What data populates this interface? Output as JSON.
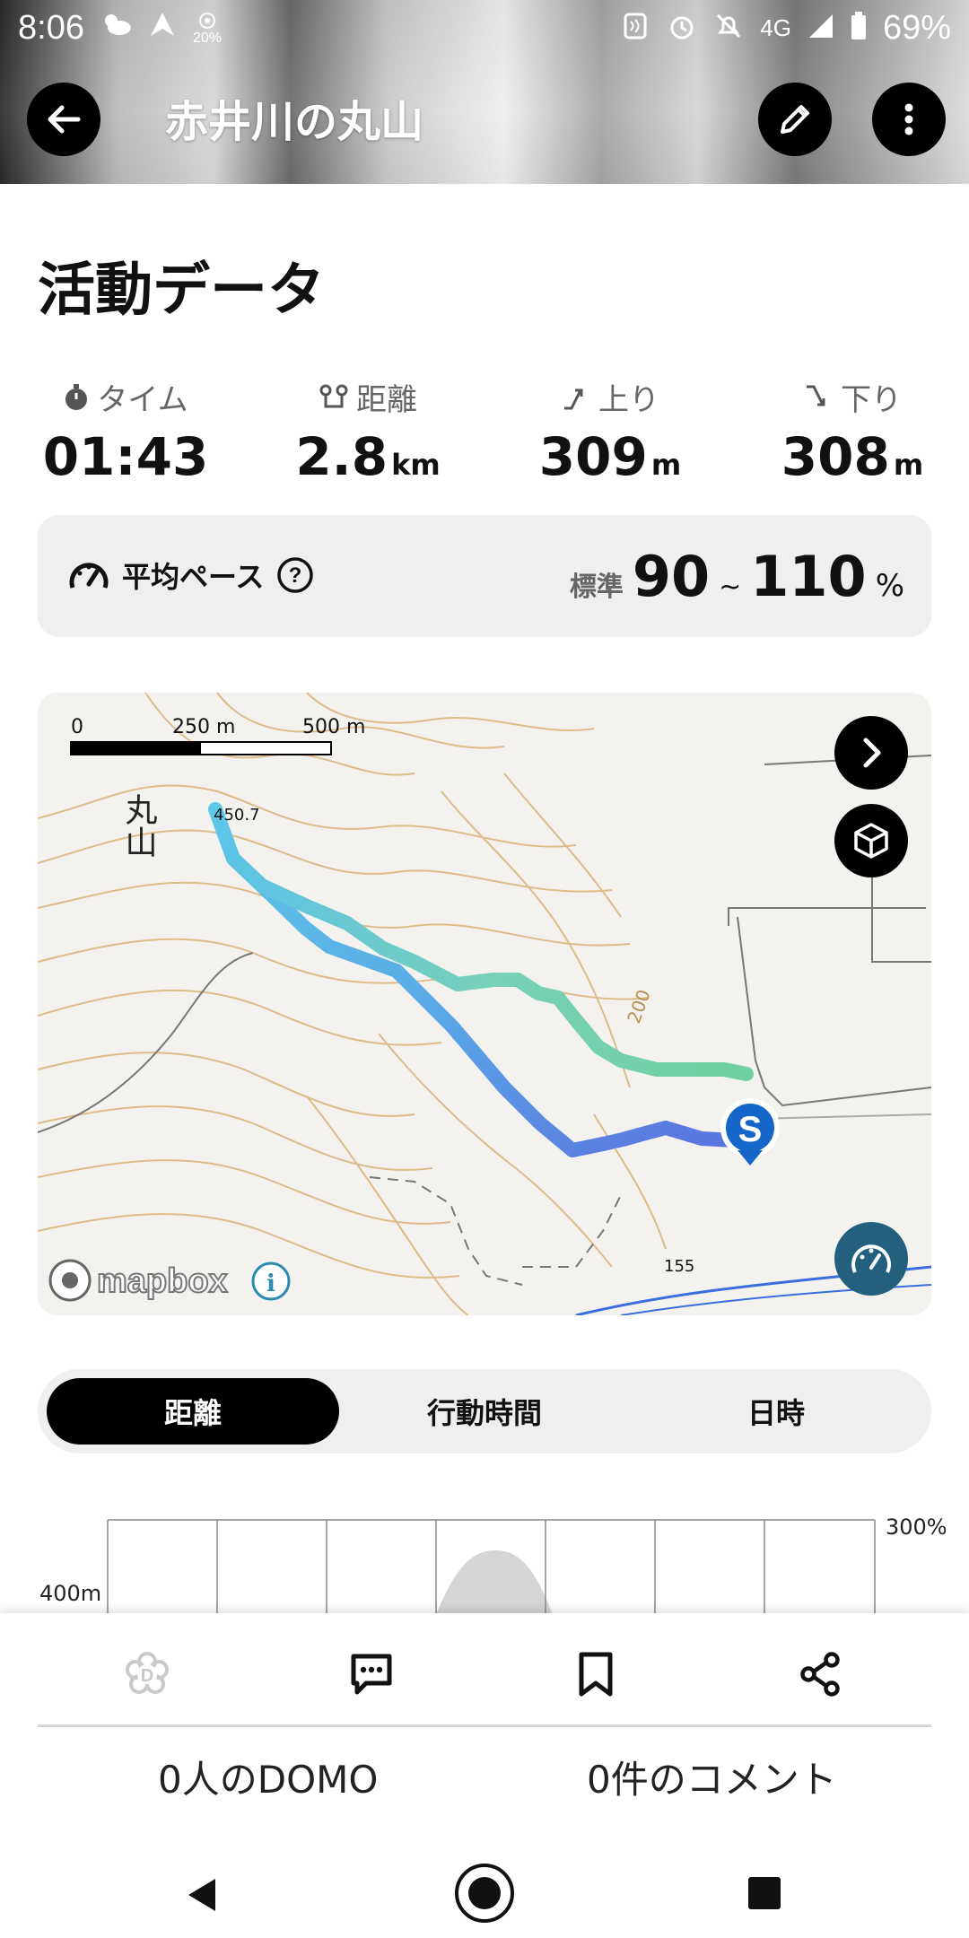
{
  "status_bar": {
    "time": "8:06",
    "temperature": "20%",
    "network": "4G",
    "battery": "69%"
  },
  "header": {
    "title": "赤井川の丸山",
    "back_icon": "arrow-left-icon",
    "edit_icon": "pencil-icon",
    "more_icon": "more-vertical-icon"
  },
  "activity": {
    "section_title": "活動データ",
    "stats": [
      {
        "label": "タイム",
        "value": "01:43",
        "unit": "",
        "icon": "stopwatch-icon"
      },
      {
        "label": "距離",
        "value": "2.8",
        "unit": "km",
        "icon": "route-icon"
      },
      {
        "label": "上り",
        "value": "309",
        "unit": "m",
        "icon": "ascent-icon"
      },
      {
        "label": "下り",
        "value": "308",
        "unit": "m",
        "icon": "descent-icon"
      }
    ],
    "pace": {
      "label": "平均ペース",
      "standard_label": "標準",
      "min": "90",
      "tilde": "~",
      "max": "110",
      "unit": "%"
    }
  },
  "map": {
    "scale_labels": [
      "0",
      "250 m",
      "500 m"
    ],
    "peak_name": "丸山",
    "peak_elevation": "450.7",
    "contour_label": "200",
    "spot_height": "155",
    "start_marker": "S",
    "attribution": "mapbox",
    "colors": {
      "track_start": "#6dd0a0",
      "track_mid": "#55b9e6",
      "track_end": "#5a6fe0",
      "marker": "#1466c8"
    }
  },
  "toggle": {
    "items": [
      "距離",
      "行動時間",
      "日時"
    ],
    "active_index": 0
  },
  "elevation_chart": {
    "y_label": "400m",
    "right_label": "300%"
  },
  "actions": {
    "domo_text": "0人のDOMO",
    "comment_text": "0件のコメント"
  }
}
